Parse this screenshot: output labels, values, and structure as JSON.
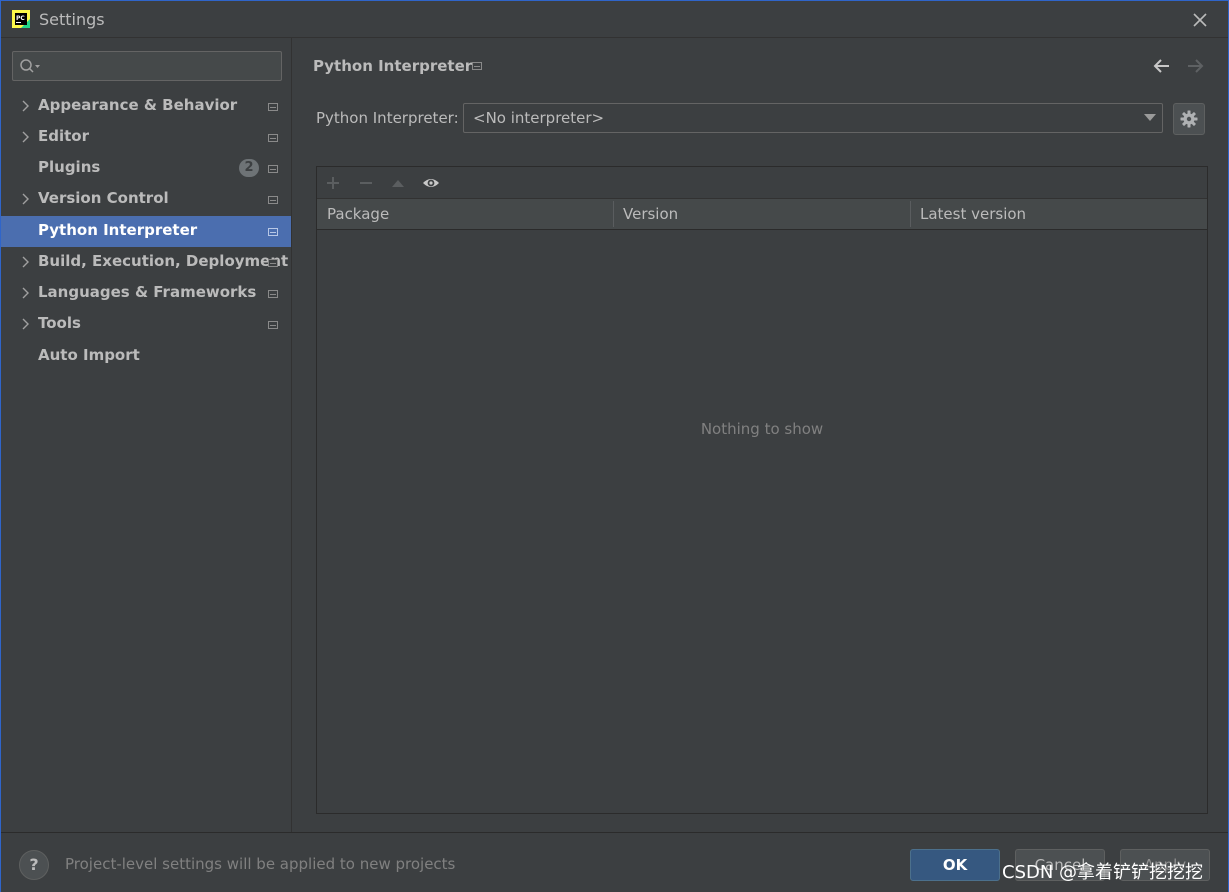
{
  "window": {
    "title": "Settings"
  },
  "search": {
    "placeholder": ""
  },
  "sidebar": {
    "items": [
      {
        "label": "Appearance & Behavior",
        "expandable": true
      },
      {
        "label": "Editor",
        "expandable": true
      },
      {
        "label": "Plugins",
        "expandable": false,
        "badge": "2"
      },
      {
        "label": "Version Control",
        "expandable": true
      },
      {
        "label": "Python Interpreter",
        "expandable": false,
        "selected": true
      },
      {
        "label": "Build, Execution, Deployment",
        "expandable": true
      },
      {
        "label": "Languages & Frameworks",
        "expandable": true
      },
      {
        "label": "Tools",
        "expandable": true
      },
      {
        "label": "Auto Import",
        "expandable": false
      }
    ]
  },
  "content": {
    "page_title": "Python Interpreter",
    "interpreter_label": "Python Interpreter:",
    "interpreter_value": "<No interpreter>",
    "table": {
      "columns": [
        "Package",
        "Version",
        "Latest version"
      ],
      "rows": [],
      "empty_text": "Nothing to show"
    }
  },
  "footer": {
    "help_label": "?",
    "info_text": "Project-level settings will be applied to new projects",
    "ok_label": "OK",
    "cancel_label": "Cancel",
    "apply_label": "Apply"
  },
  "watermark": "CSDN @拿着铲铲挖挖挖",
  "colors": {
    "background": "#3c3f41",
    "selection": "#4b6eaf",
    "ok_button": "#365880",
    "window_border": "#2f65ca"
  }
}
